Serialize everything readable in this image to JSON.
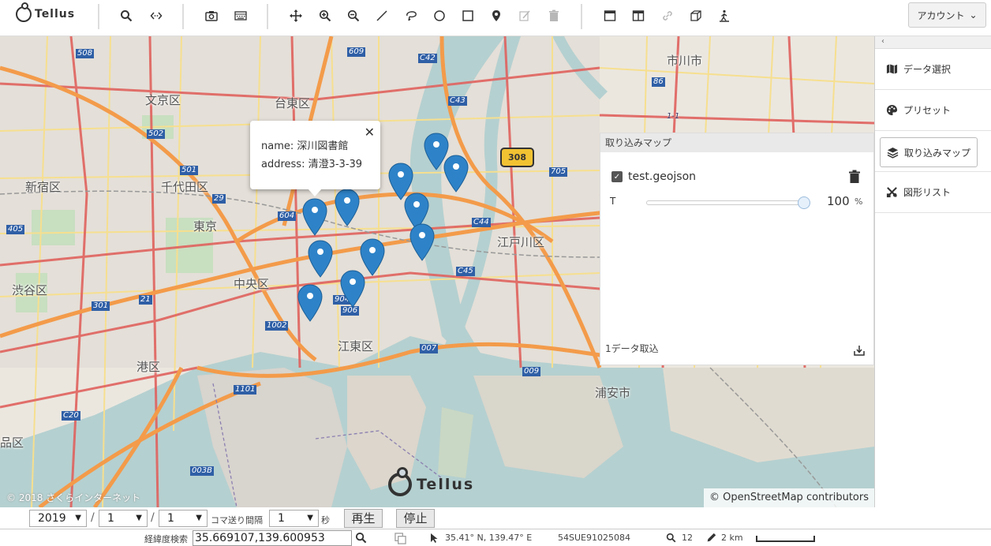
{
  "app": {
    "logo_text": "Tellus"
  },
  "toolbar": {
    "tools": [
      "search-icon",
      "embed-code-icon",
      "camera-icon",
      "keyboard-icon",
      "move-icon",
      "zoom-in-icon",
      "zoom-out-icon",
      "line-icon",
      "lasso-icon",
      "circle-icon",
      "square-icon",
      "pin-icon",
      "edit-icon",
      "trash-icon",
      "window-single-icon",
      "window-split-icon",
      "link-icon",
      "cube-icon",
      "walk-icon"
    ],
    "account_label": "アカウント"
  },
  "map": {
    "labels": {
      "ichikawa": "市川市",
      "bunkyo": "文京区",
      "taito": "台東区",
      "shinjuku": "新宿区",
      "chiyoda": "千代田区",
      "tokyo": "東京",
      "chuo": "中央区",
      "shibuya": "渋谷区",
      "minato": "港区",
      "koto": "江東区",
      "edogawa": "江戸川区",
      "urayasu": "浦安市",
      "shinagawa": "品区"
    },
    "routes": [
      "508",
      "609",
      "C42",
      "C43",
      "502",
      "501",
      "405",
      "29",
      "604",
      "705",
      "C44",
      "C45",
      "301",
      "21",
      "904",
      "906",
      "1002",
      "007",
      "009",
      "1101",
      "C20",
      "003B",
      "86",
      "1-1"
    ],
    "shield": "308",
    "popup": {
      "name_line": "name: 深川図書館",
      "address_line": "address: 清澄3-3-39",
      "close": "✕"
    },
    "watermark": "Tellus",
    "copyright": "© 2018 さくらインターネット",
    "attribution": "© OpenStreetMap contributors"
  },
  "import_panel": {
    "title": "取り込みマップ",
    "layer_name": "test.geojson",
    "layer_checked": true,
    "opacity_label": "T",
    "opacity_value": "100",
    "opacity_unit": "%",
    "opacity_fraction": 1.0,
    "count_text": "1データ取込"
  },
  "sidebar": {
    "collapse": "‹",
    "items": [
      {
        "label": "データ選択",
        "icon": "map-icon"
      },
      {
        "label": "プリセット",
        "icon": "palette-icon"
      },
      {
        "label": "取り込みマップ",
        "icon": "layers-icon"
      },
      {
        "label": "図形リスト",
        "icon": "shapes-icon"
      }
    ]
  },
  "timebar": {
    "year": "2019",
    "month": "1",
    "day": "1",
    "step_label": "コマ送り間隔",
    "step_value": "1",
    "unit": "秒",
    "play": "再生",
    "stop": "停止",
    "sep": "/"
  },
  "statusbar": {
    "search_label": "経緯度検索",
    "coord_value": "35.669107,139.600953",
    "cursor_pos": "35.41° N, 139.47° E",
    "mgrs": "54SUE91025084",
    "zoom": "12",
    "scale": "2 km"
  },
  "colors": {
    "motorway": "#f39b4a",
    "primary": "#e0625e",
    "water": "#b5d0d0",
    "marker": "#2e83c8"
  }
}
